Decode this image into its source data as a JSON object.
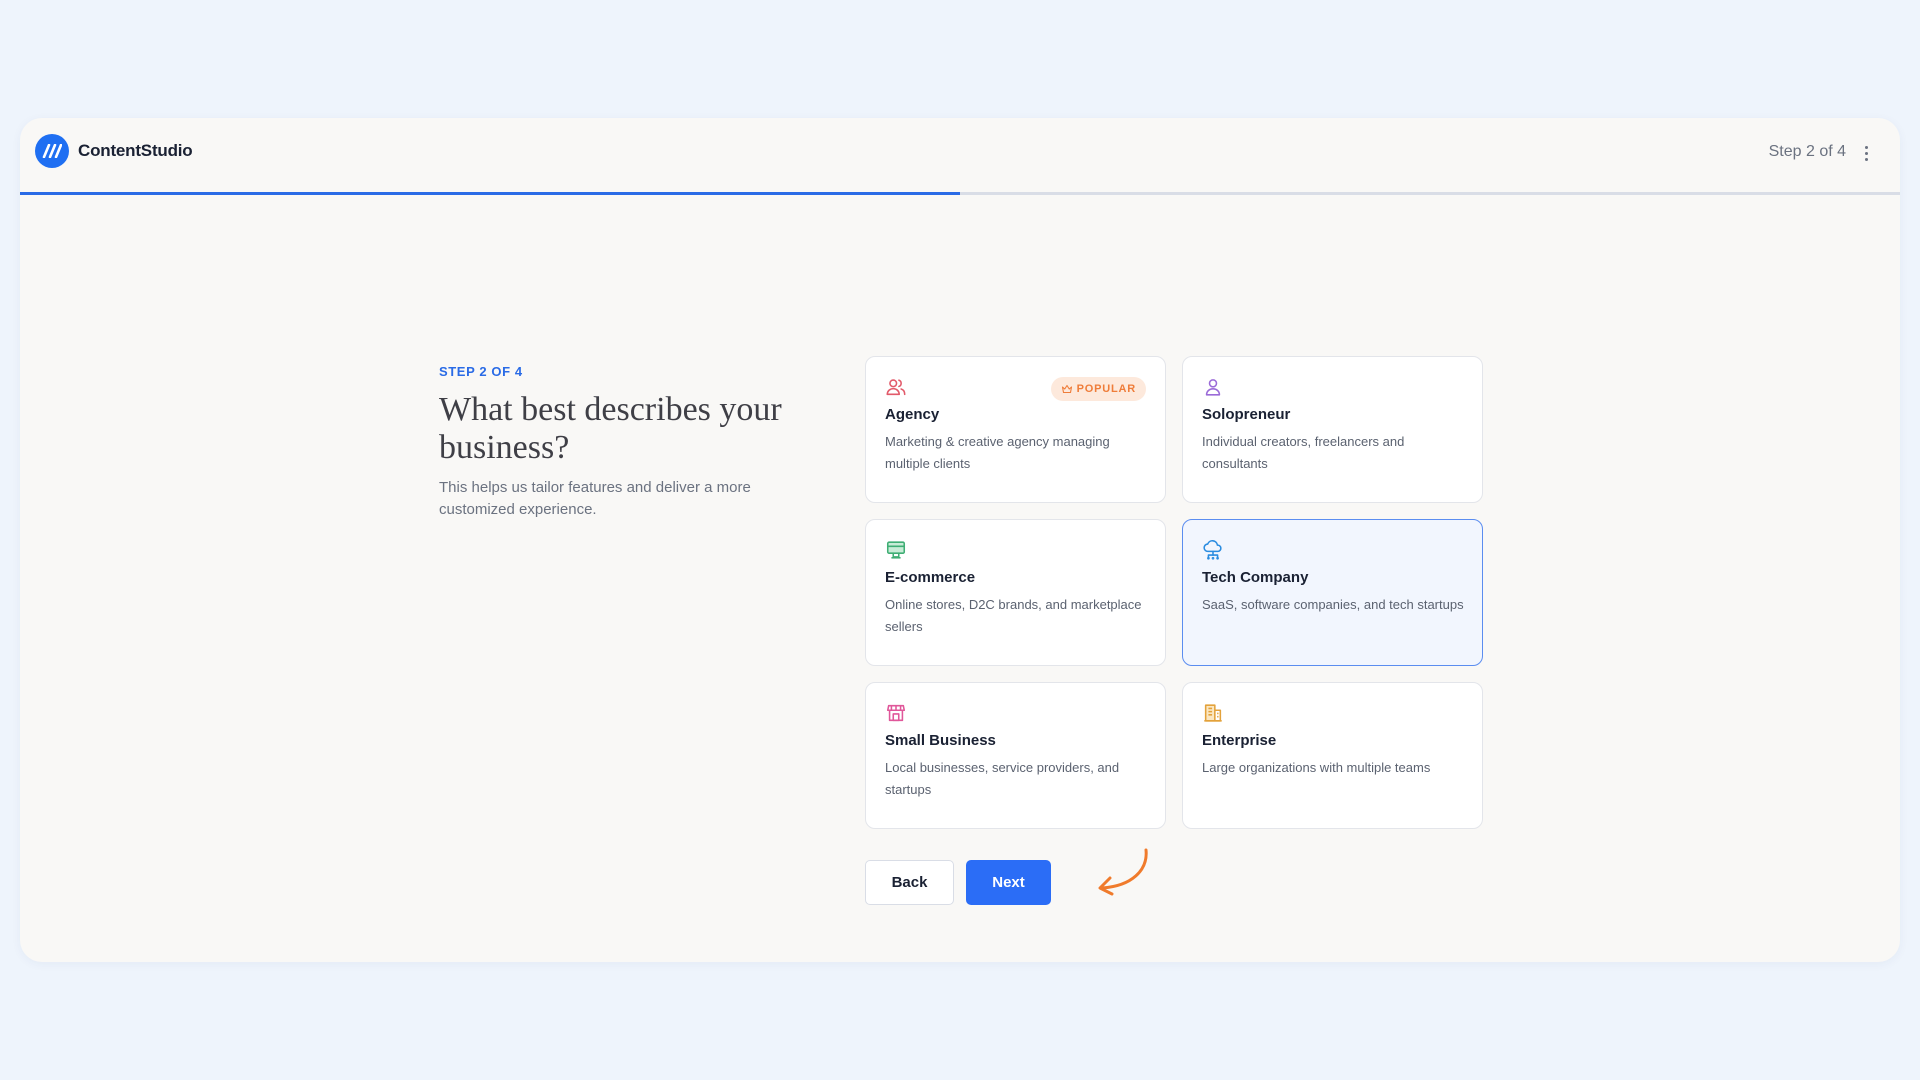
{
  "app": {
    "name": "ContentStudio",
    "step_indicator": "Step 2 of 4"
  },
  "progress": {
    "fraction": 0.5
  },
  "intro": {
    "eyebrow": "STEP 2 OF 4",
    "heading": "What best describes your business?",
    "subtext": "This helps us tailor features and deliver a more customized experience."
  },
  "options": [
    {
      "title": "Agency",
      "description": "Marketing & creative agency managing multiple clients",
      "icon": "users-icon",
      "icon_color": "#e25a6a",
      "badge": "POPULAR",
      "selected": false
    },
    {
      "title": "Solopreneur",
      "description": "Individual creators, freelancers and consultants",
      "icon": "user-icon",
      "icon_color": "#9b6bd8",
      "selected": false
    },
    {
      "title": "E-commerce",
      "description": "Online stores, D2C brands, and marketplace sellers",
      "icon": "storefront-icon",
      "icon_color": "#3fae74",
      "selected": false
    },
    {
      "title": "Tech Company",
      "description": "SaaS, software companies, and tech startups",
      "icon": "cloud-network-icon",
      "icon_color": "#2a8ce0",
      "selected": true
    },
    {
      "title": "Small Business",
      "description": "Local businesses, service providers, and startups",
      "icon": "shop-icon",
      "icon_color": "#e0579a",
      "selected": false
    },
    {
      "title": "Enterprise",
      "description": "Large organizations with multiple teams",
      "icon": "building-icon",
      "icon_color": "#e3a23b",
      "selected": false
    }
  ],
  "buttons": {
    "back": "Back",
    "next": "Next"
  },
  "colors": {
    "accent": "#2b6df6",
    "badge_text": "#ef7d3a",
    "arrow": "#f07b2c"
  }
}
